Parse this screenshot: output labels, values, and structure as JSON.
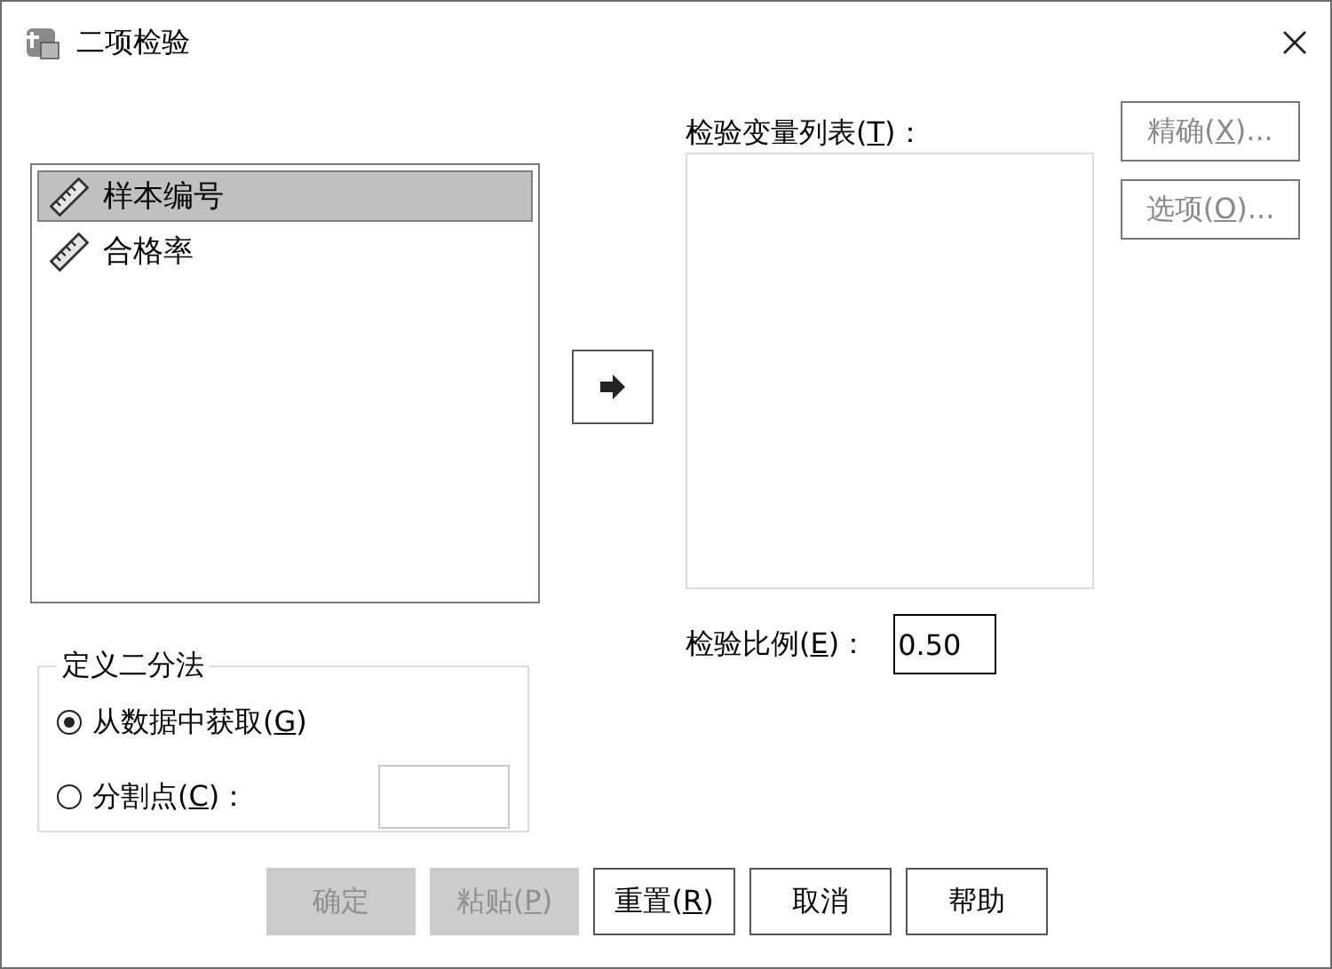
{
  "window": {
    "title": "二项检验"
  },
  "source_list": {
    "items": [
      {
        "label": "样本编号",
        "selected": true
      },
      {
        "label": "合格率",
        "selected": false
      }
    ]
  },
  "test_variables": {
    "label": {
      "before": "检验变量列表(",
      "key": "T",
      "after": ")："
    }
  },
  "side_buttons": [
    {
      "before": "精确(",
      "key": "X",
      "after": ")...",
      "disabled": true
    },
    {
      "before": "选项(",
      "key": "O",
      "after": ")...",
      "disabled": true
    }
  ],
  "dichotomy": {
    "title": "定义二分法",
    "options": [
      {
        "kind": "plain",
        "before": "从数据中获取(",
        "key": "G",
        "after": ")",
        "selected": true
      },
      {
        "kind": "with_field",
        "before": "分割点(",
        "key": "C",
        "after": ")：",
        "selected": false
      }
    ]
  },
  "test_ratio": {
    "label": {
      "before": "检验比例(",
      "key": "E",
      "after": ")："
    },
    "value": "0.50"
  },
  "buttons": [
    {
      "before": "确定",
      "disabled": true
    },
    {
      "before": "粘贴(",
      "key": "P",
      "after": ")",
      "disabled": true
    },
    {
      "before": "重置(",
      "key": "R",
      "after": ")",
      "disabled": false
    },
    {
      "before": "取消",
      "disabled": false
    },
    {
      "before": "帮助",
      "disabled": false
    }
  ]
}
